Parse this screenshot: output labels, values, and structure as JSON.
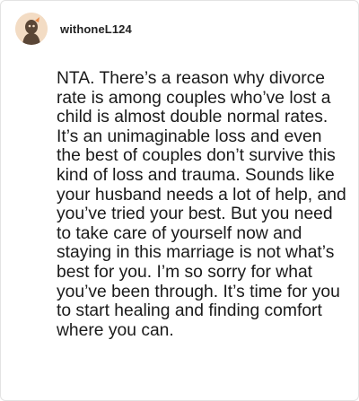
{
  "comment": {
    "username": "withoneL124",
    "avatar_icon": "user-avatar-icon",
    "text": "NTA. There’s a reason why divorce rate is among couples who’ve lost a child is almost double normal rates. It’s an unimaginable loss and even the best of couples don’t survive this kind of loss and trauma. Sounds like your husband needs a lot of help, and you’ve tried your best. But you need to take care of yourself now and staying in this marriage is not what’s best for you. I’m so sorry for what you’ve been through. It’s time for you to start healing and finding comfort where you can."
  },
  "colors": {
    "avatar_background": "#f3dcc4",
    "avatar_figure": "#5a4636",
    "text": "#1a1a1a",
    "border": "#e3e3e3"
  }
}
